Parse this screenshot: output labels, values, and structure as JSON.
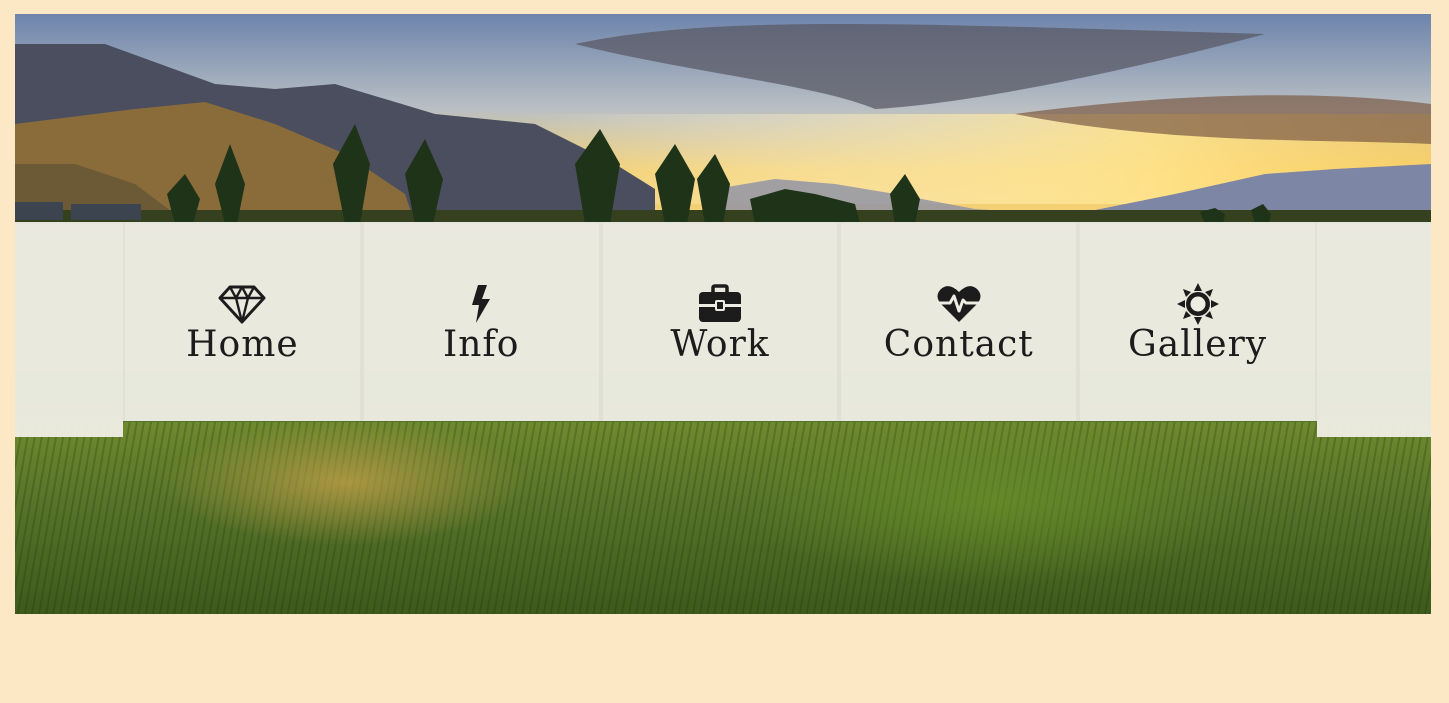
{
  "nav": {
    "items": [
      {
        "label": "Home",
        "icon": "diamond-icon"
      },
      {
        "label": "Info",
        "icon": "bolt-icon"
      },
      {
        "label": "Work",
        "icon": "briefcase-icon"
      },
      {
        "label": "Contact",
        "icon": "heartbeat-icon"
      },
      {
        "label": "Gallery",
        "icon": "sun-icon"
      }
    ]
  },
  "colors": {
    "page_background": "#fde8c6",
    "nav_background": "#eeede4",
    "text": "#1c1c1c"
  }
}
